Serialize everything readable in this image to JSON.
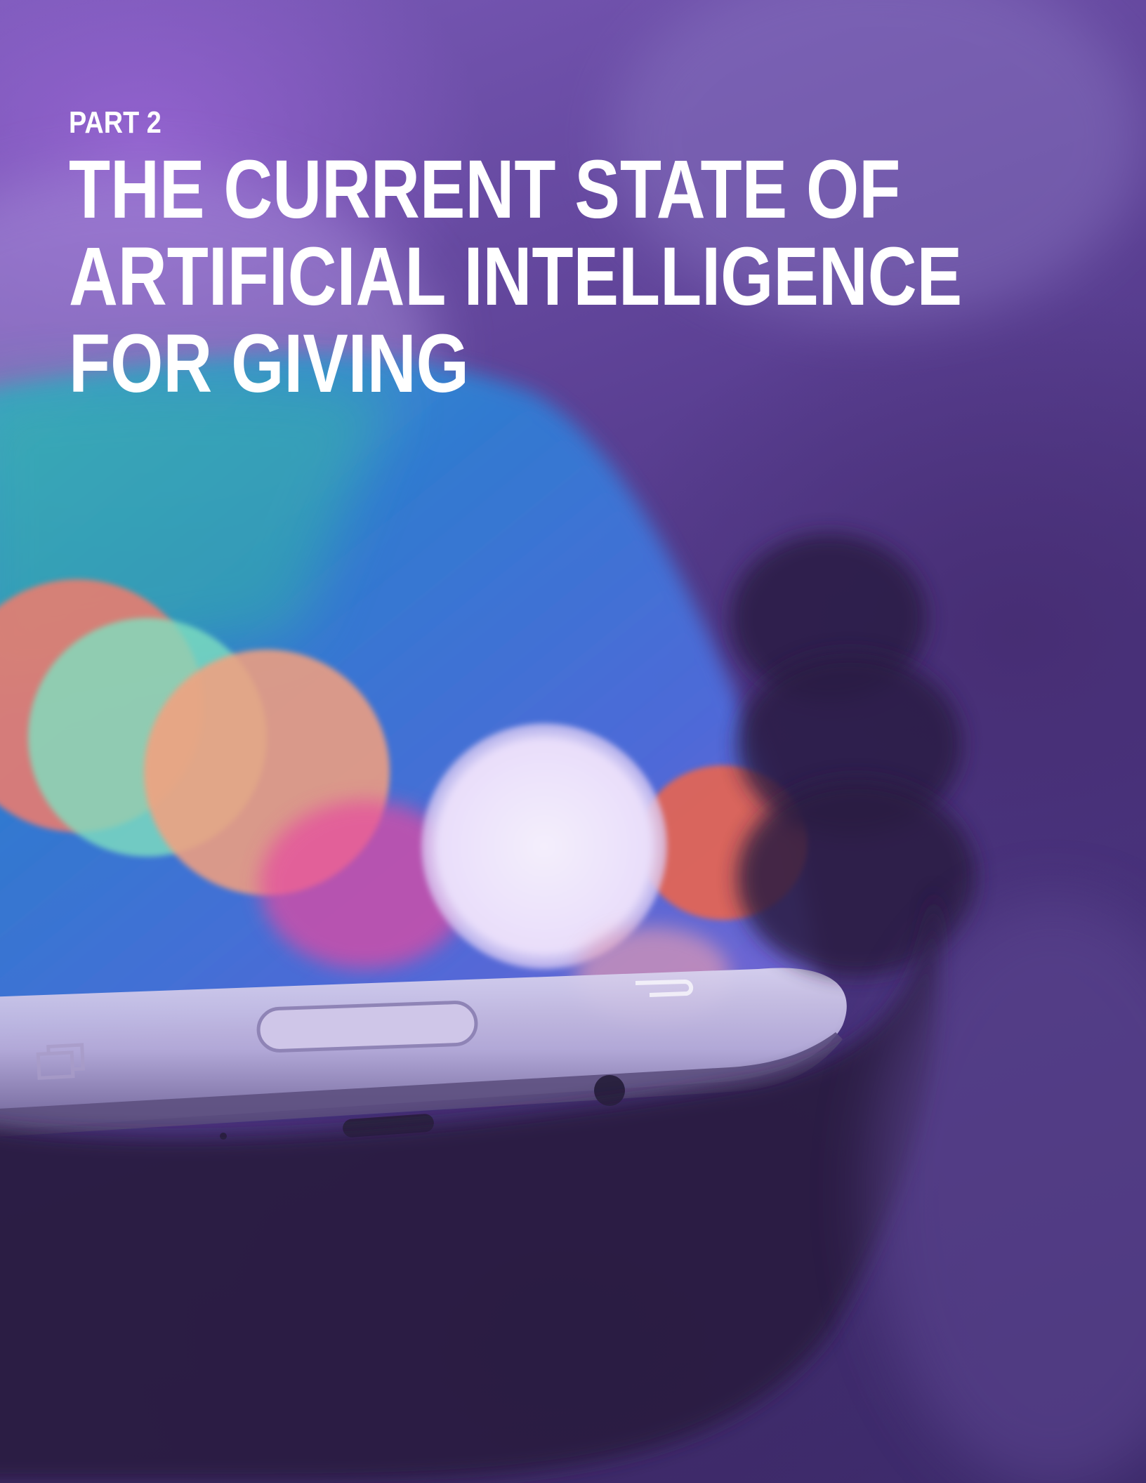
{
  "header": {
    "part_label": "PART 2",
    "title_lines": [
      "THE CURRENT STATE OF",
      "ARTIFICIAL INTELLIGENCE",
      "FOR GIVING"
    ]
  },
  "colors": {
    "title_text": "#ffffff",
    "background_accent": "#5a3f92"
  }
}
